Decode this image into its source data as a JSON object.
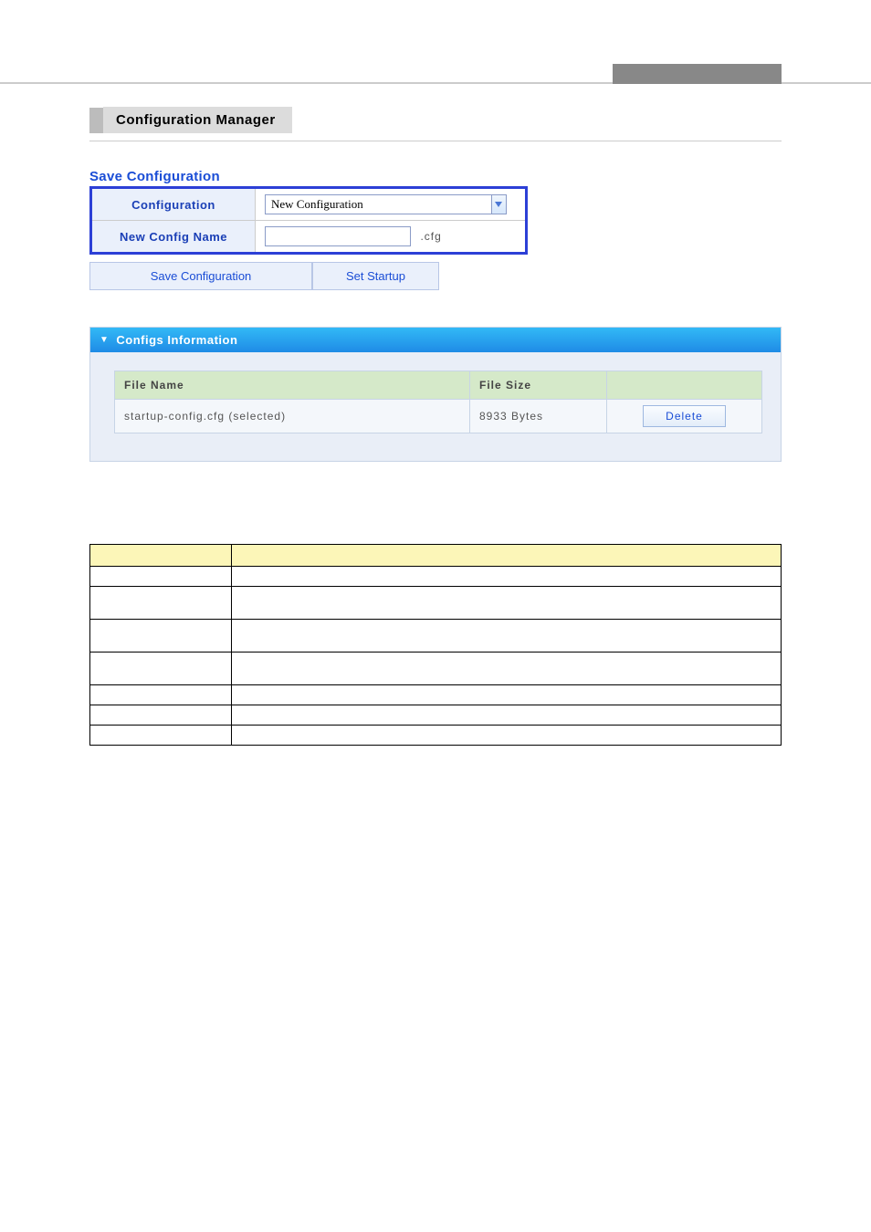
{
  "pageTitle": "Configuration Manager",
  "saveConfig": {
    "sectionTitle": "Save Configuration",
    "rowConfigLabel": "Configuration",
    "configSelected": "New Configuration",
    "rowNewNameLabel": "New Config Name",
    "newNameValue": "",
    "suffix": ".cfg",
    "btnSave": "Save Configuration",
    "btnSetStartup": "Set Startup"
  },
  "configsInfo": {
    "header": "Configs Information",
    "columns": {
      "fileName": "File Name",
      "fileSize": "File Size"
    },
    "rows": [
      {
        "fileName": "startup-config.cfg (selected)",
        "fileSize": "8933 Bytes"
      }
    ],
    "deleteLabel": "Delete"
  }
}
